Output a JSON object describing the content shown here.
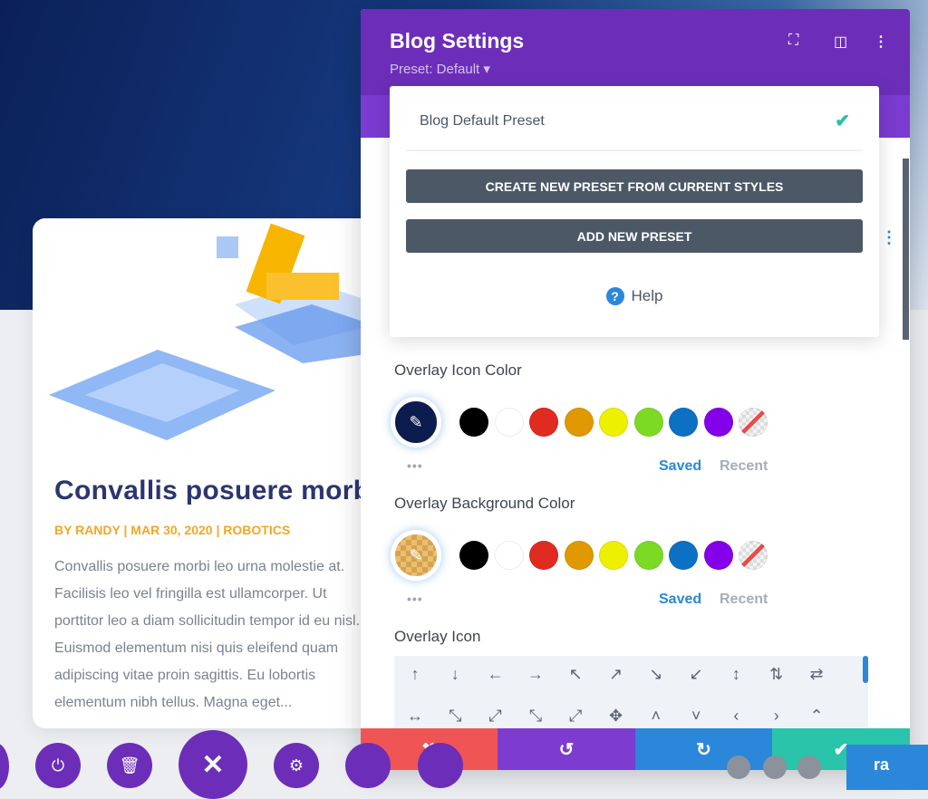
{
  "post": {
    "title": "Convallis posuere morbi",
    "meta": "BY RANDY | MAR 30, 2020 | ROBOTICS",
    "excerpt": "Convallis posuere morbi leo urna molestie at. Facilisis leo vel fringilla est ullamcorper. Ut porttitor leo a diam sollicitudin tempor id eu nisl. Euismod elementum nisi quis eleifend quam adipiscing vitae proin sagittis. Eu lobortis elementum nibh tellus. Magna eget..."
  },
  "panel": {
    "title": "Blog Settings",
    "preset": "Preset: Default ▾",
    "icons": [
      "fullscreen-icon",
      "split-view-icon",
      "more-icon"
    ]
  },
  "dropdown": {
    "item": "Blog Default Preset",
    "create_btn": "CREATE NEW PRESET FROM CURRENT STYLES",
    "add_btn": "ADD NEW PRESET",
    "help": "Help"
  },
  "overlay_icon_color": {
    "label": "Overlay Icon Color",
    "selected": "#0c1c4e",
    "saved": "Saved",
    "recent": "Recent"
  },
  "overlay_bg_color": {
    "label": "Overlay Background Color",
    "selected": "#d8a24a",
    "saved": "Saved",
    "recent": "Recent"
  },
  "swatches": [
    "#000000",
    "#ffffff",
    "#e02b20",
    "#e09900",
    "#edf000",
    "#7cda24",
    "#0c71c3",
    "#8300e9",
    "transparent"
  ],
  "overlay_icon": {
    "label": "Overlay Icon",
    "row1": [
      "↑",
      "↓",
      "←",
      "→",
      "↖",
      "↗",
      "↘",
      "↙",
      "↕",
      "⇅",
      "⇄"
    ],
    "row2": [
      "↔",
      "⤡",
      "⤢",
      "⤡",
      "⤢",
      "✥",
      "˄",
      "˅",
      "‹",
      "›",
      "⌃"
    ]
  },
  "footer": {
    "colors": [
      "#ef5555",
      "#7e3bd0",
      "#2b87da",
      "#29c4a9"
    ],
    "icons": [
      "✖",
      "↺",
      "↻",
      "✔"
    ]
  },
  "bottom_bar": {
    "button_text": "ra"
  }
}
